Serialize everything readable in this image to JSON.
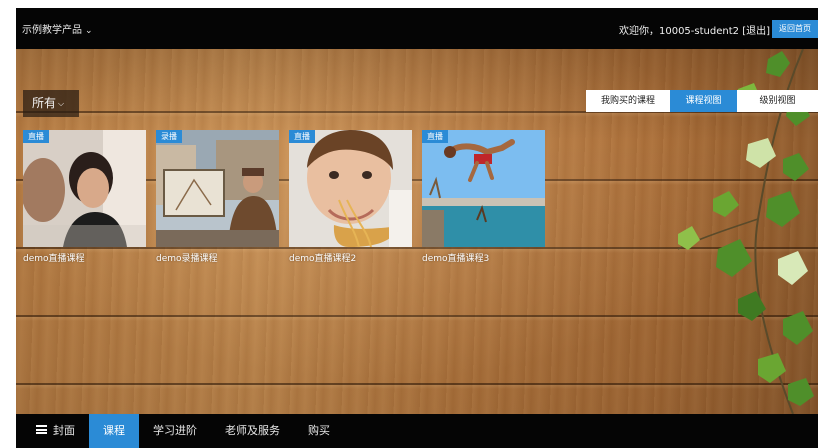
{
  "header": {
    "product_selector": "示例教学产品",
    "welcome_text": "欢迎你，10005-student2",
    "logout_link": "[退出]",
    "home_button": "返回首页"
  },
  "filter": {
    "selected": "所有"
  },
  "view_tabs": {
    "items": [
      {
        "label": "我购买的课程",
        "active": false
      },
      {
        "label": "课程视图",
        "active": true
      },
      {
        "label": "级别视图",
        "active": false
      }
    ]
  },
  "courses": [
    {
      "badge": "直播",
      "title": "demo直播课程"
    },
    {
      "badge": "录播",
      "title": "demo录播课程"
    },
    {
      "badge": "直播",
      "title": "demo直播课程2"
    },
    {
      "badge": "直播",
      "title": "demo直播课程3"
    }
  ],
  "bottom_nav": {
    "items": [
      {
        "label": "封面",
        "icon": "menu-icon",
        "active": false
      },
      {
        "label": "课程",
        "active": true
      },
      {
        "label": "学习进阶",
        "active": false
      },
      {
        "label": "老师及服务",
        "active": false
      },
      {
        "label": "购买",
        "active": false
      }
    ]
  },
  "colors": {
    "accent": "#2b8bd6",
    "bar": "#050505"
  }
}
